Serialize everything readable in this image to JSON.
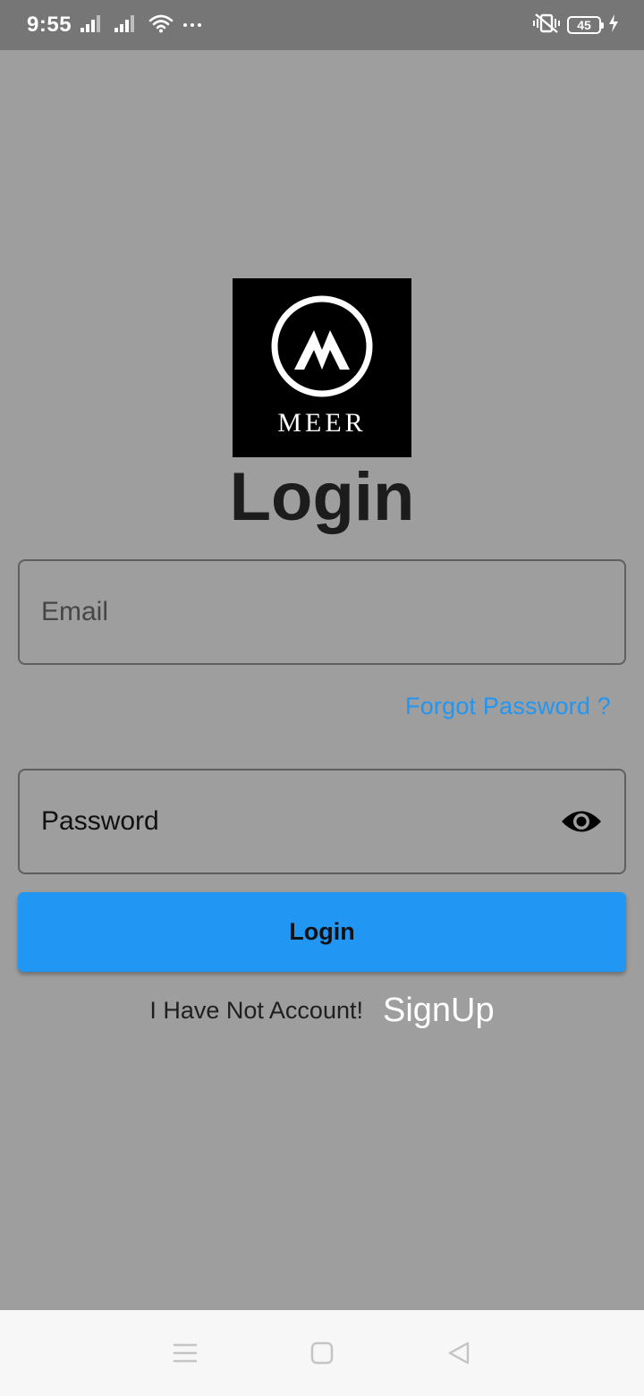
{
  "status_bar": {
    "time": "9:55",
    "battery_level": "45",
    "icons": [
      "signal-icon",
      "signal-icon",
      "wifi-icon",
      "more-dots-icon",
      "vibrate-off-icon",
      "battery-icon",
      "charging-icon"
    ]
  },
  "logo": {
    "text": "MEER",
    "icon": "meer-m-logo-icon"
  },
  "page_title": "Login",
  "email_field": {
    "placeholder": "Email",
    "value": ""
  },
  "forgot_password_label": "Forgot Password ?",
  "password_field": {
    "placeholder": "Password",
    "value": "",
    "toggle_icon": "eye-icon"
  },
  "login_button_label": "Login",
  "signup_prompt": "I Have Not Account!",
  "signup_link": "SignUp",
  "nav_bar": {
    "icons": [
      "menu-icon",
      "home-square-icon",
      "back-triangle-icon"
    ]
  },
  "colors": {
    "background": "#9e9e9e",
    "status_bar": "#767676",
    "accent": "#2196f3",
    "nav_bar": "#f7f7f7"
  }
}
